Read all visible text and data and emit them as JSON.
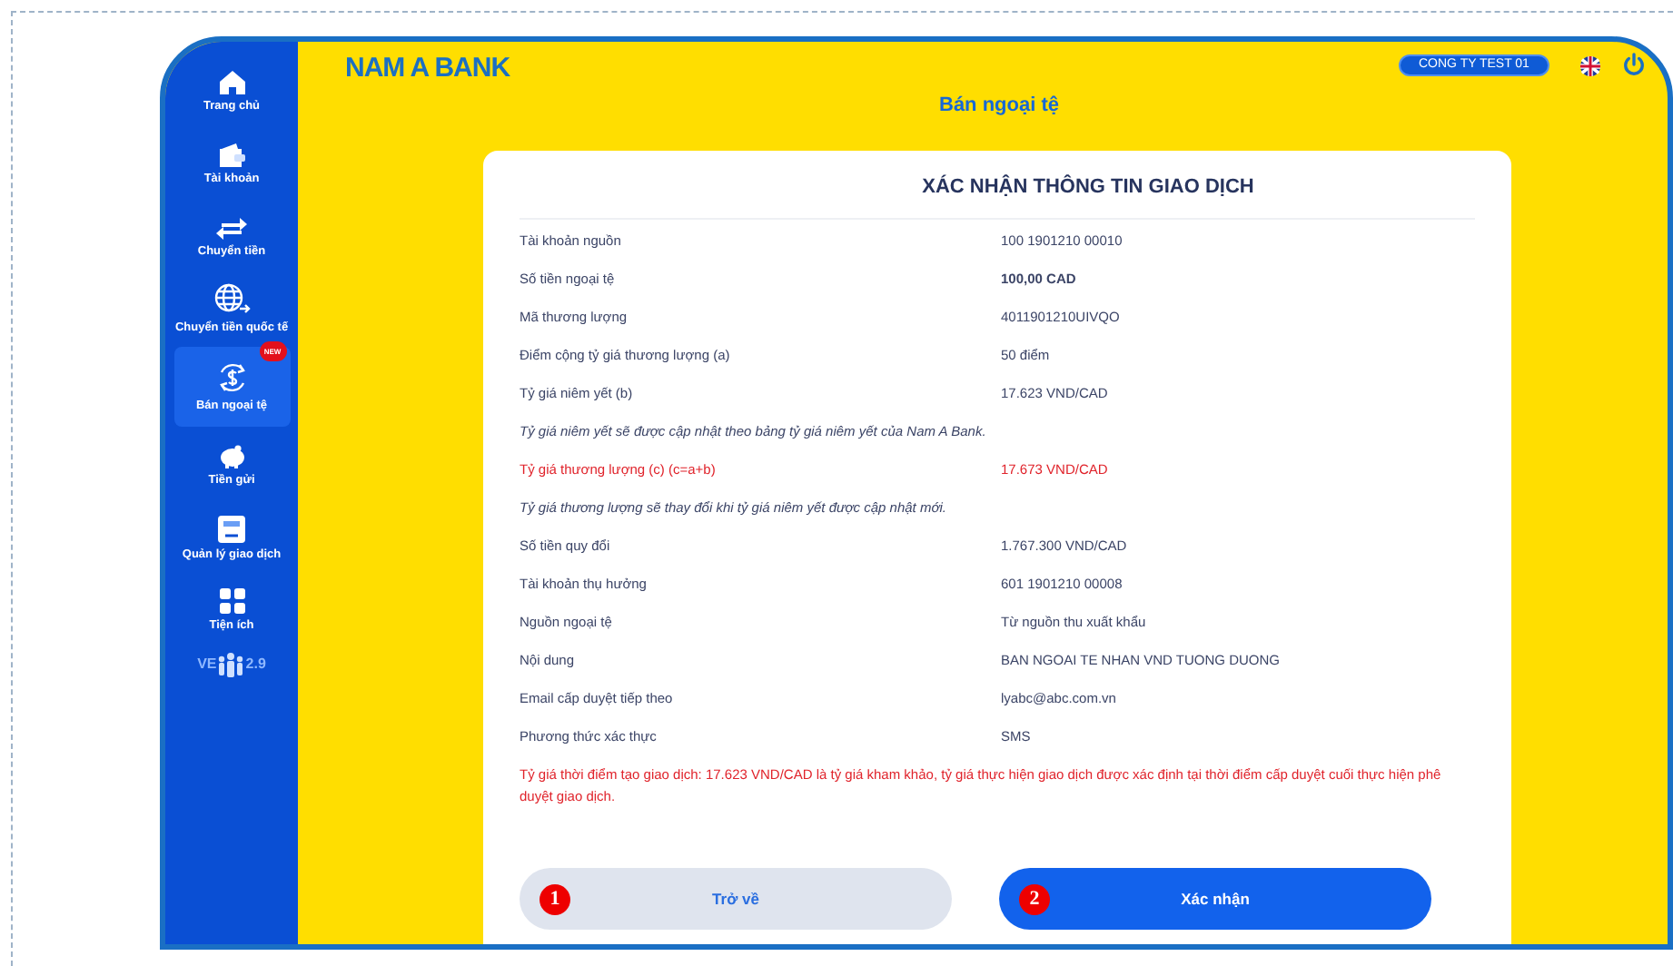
{
  "sidebar": {
    "items": [
      {
        "label": "Trang chủ",
        "kind": "home",
        "selected": false
      },
      {
        "label": "Tài khoản",
        "kind": "wallet",
        "selected": false
      },
      {
        "label": "Chuyển tiền",
        "kind": "transfer",
        "selected": false
      },
      {
        "label": "Chuyển tiền quốc tế",
        "kind": "globe",
        "selected": false
      },
      {
        "label": "Bán ngoại tệ",
        "kind": "exchange",
        "selected": true,
        "badge": "NEW"
      },
      {
        "label": "Tiền gửi",
        "kind": "piggy",
        "selected": false
      },
      {
        "label": "Quản lý giao dịch",
        "kind": "card",
        "selected": false
      },
      {
        "label": "Tiện ích",
        "kind": "grid",
        "selected": false
      }
    ],
    "version_start": "VE",
    "version_end": "2.9"
  },
  "header": {
    "logo": "NAM A BANK",
    "page_title": "Bán ngoại tệ",
    "company": "CONG TY TEST 01"
  },
  "card": {
    "title": "XÁC NHẬN THÔNG TIN GIAO DỊCH",
    "rows": [
      {
        "kind": "row",
        "label": "Tài khoản nguồn",
        "value": "100 1901210 00010"
      },
      {
        "kind": "row-bold",
        "label": "Số tiền ngoại tệ",
        "value": "100,00 CAD"
      },
      {
        "kind": "row",
        "label": "Mã thương lượng",
        "value": "4011901210UIVQO"
      },
      {
        "kind": "row",
        "label": "Điểm cộng tỷ giá thương lượng (a)",
        "value": "50 điểm"
      },
      {
        "kind": "row",
        "label": "Tỷ giá niêm yết (b)",
        "value": "17.623 VND/CAD"
      },
      {
        "kind": "note",
        "text": "Tỷ giá niêm yết sẽ được cập nhật theo bảng tỷ giá niêm yết của Nam A Bank."
      },
      {
        "kind": "row-red",
        "label": "Tỷ giá thương lượng (c) (c=a+b)",
        "value": "17.673 VND/CAD"
      },
      {
        "kind": "note",
        "text": "Tỷ giá thương lượng sẽ thay đổi khi tỷ giá niêm yết được cập nhật mới."
      },
      {
        "kind": "row",
        "label": "Số tiền quy đổi",
        "value": "1.767.300 VND/CAD"
      },
      {
        "kind": "row",
        "label": "Tài khoản thụ hưởng",
        "value": "601 1901210 00008"
      },
      {
        "kind": "row",
        "label": "Nguồn ngoại tệ",
        "value": "Từ nguồn thu xuất khẩu"
      },
      {
        "kind": "row",
        "label": "Nội dung",
        "value": "BAN NGOAI TE NHAN VND TUONG DUONG"
      },
      {
        "kind": "row",
        "label": "Email cấp duyệt tiếp theo",
        "value": "lyabc@abc.com.vn"
      },
      {
        "kind": "row",
        "label": "Phương thức xác thực",
        "value": "SMS"
      },
      {
        "kind": "warning",
        "text": "Tỷ giá thời điểm tạo giao dịch: 17.623 VND/CAD là tỷ giá kham khảo, tỷ giá thực hiện giao dịch được xác định tại thời điểm cấp duyệt cuối thực hiện phê duyệt giao dịch."
      }
    ],
    "buttons": [
      {
        "kind": "secondary",
        "label": "Trở về",
        "step": "1"
      },
      {
        "kind": "primary",
        "label": "Xác nhận",
        "step": "2"
      }
    ]
  }
}
